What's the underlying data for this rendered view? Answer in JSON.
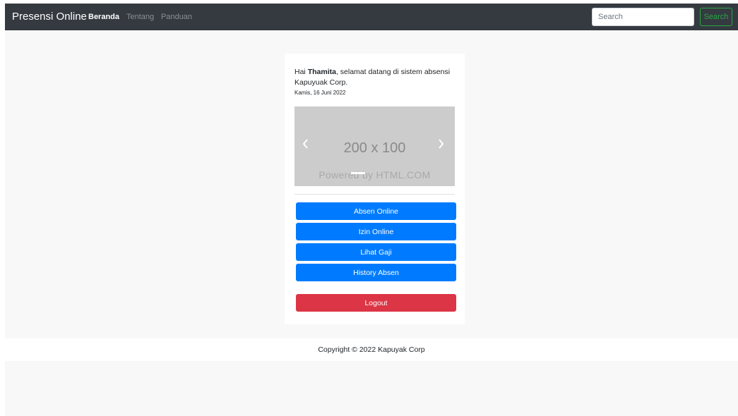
{
  "navbar": {
    "brand": "Presensi Online",
    "links": [
      {
        "label": "Beranda",
        "active": true
      },
      {
        "label": "Tentang",
        "active": false
      },
      {
        "label": "Panduan",
        "active": false
      }
    ],
    "search": {
      "placeholder": "Search",
      "button_label": "Search"
    }
  },
  "card": {
    "greeting_prefix": "Hai ",
    "user_name": "Thamita",
    "greeting_suffix": ", selamat datang di sistem absensi Kapuyuak Corp.",
    "date": "Kamis, 16 Juni 2022",
    "carousel": {
      "size_text": "200 x 100",
      "watermark": "Powered by HTML.COM",
      "prev_icon": "chevron-left-icon",
      "next_icon": "chevron-right-icon"
    },
    "buttons": [
      {
        "label": "Absen Online"
      },
      {
        "label": "Izin Online"
      },
      {
        "label": "Lihat Gaji"
      },
      {
        "label": "History Absen"
      }
    ],
    "logout_label": "Logout"
  },
  "footer": {
    "copyright": "Copyright © 2022 Kapuyak Corp"
  },
  "colors": {
    "navbar_bg": "#343a40",
    "primary": "#007bff",
    "danger": "#dc3545",
    "success": "#28a745",
    "page_bg": "#f8f8f8"
  }
}
